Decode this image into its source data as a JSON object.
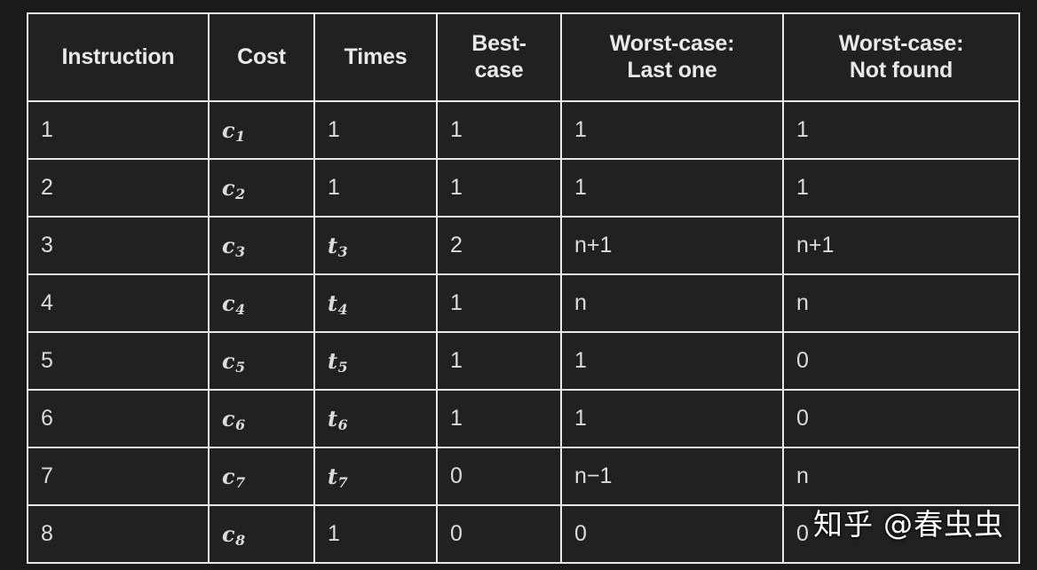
{
  "table": {
    "columns": [
      {
        "key": "instruction",
        "label": "Instruction"
      },
      {
        "key": "cost",
        "label": "Cost"
      },
      {
        "key": "times",
        "label": "Times"
      },
      {
        "key": "best_case",
        "label": "Best-case"
      },
      {
        "key": "worst_last",
        "label": "Worst-case: Last one"
      },
      {
        "key": "worst_notfound",
        "label": "Worst-case: Not found"
      }
    ],
    "header": {
      "instruction": "Instruction",
      "cost": "Cost",
      "times": "Times",
      "best_case_line1": "Best-",
      "best_case_line2": "case",
      "worst_last_line1": "Worst-case:",
      "worst_last_line2": "Last one",
      "worst_notfound_line1": "Worst-case:",
      "worst_notfound_line2": "Not found"
    },
    "rows": [
      {
        "instruction": "1",
        "cost_symbol": "c",
        "cost_sub": "1",
        "times": "1",
        "times_symbol": "",
        "times_sub": "",
        "times_is_math": false,
        "best_case": "1",
        "worst_last": "1",
        "worst_notfound": "1"
      },
      {
        "instruction": "2",
        "cost_symbol": "c",
        "cost_sub": "2",
        "times": "1",
        "times_symbol": "",
        "times_sub": "",
        "times_is_math": false,
        "best_case": "1",
        "worst_last": "1",
        "worst_notfound": "1"
      },
      {
        "instruction": "3",
        "cost_symbol": "c",
        "cost_sub": "3",
        "times": "",
        "times_symbol": "t",
        "times_sub": "3",
        "times_is_math": true,
        "best_case": "2",
        "worst_last": "n+1",
        "worst_notfound": "n+1"
      },
      {
        "instruction": "4",
        "cost_symbol": "c",
        "cost_sub": "4",
        "times": "",
        "times_symbol": "t",
        "times_sub": "4",
        "times_is_math": true,
        "best_case": "1",
        "worst_last": "n",
        "worst_notfound": "n"
      },
      {
        "instruction": "5",
        "cost_symbol": "c",
        "cost_sub": "5",
        "times": "",
        "times_symbol": "t",
        "times_sub": "5",
        "times_is_math": true,
        "best_case": "1",
        "worst_last": "1",
        "worst_notfound": "0"
      },
      {
        "instruction": "6",
        "cost_symbol": "c",
        "cost_sub": "6",
        "times": "",
        "times_symbol": "t",
        "times_sub": "6",
        "times_is_math": true,
        "best_case": "1",
        "worst_last": "1",
        "worst_notfound": "0"
      },
      {
        "instruction": "7",
        "cost_symbol": "c",
        "cost_sub": "7",
        "times": "",
        "times_symbol": "t",
        "times_sub": "7",
        "times_is_math": true,
        "best_case": "0",
        "worst_last": "n−1",
        "worst_notfound": "n"
      },
      {
        "instruction": "8",
        "cost_symbol": "c",
        "cost_sub": "8",
        "times": "1",
        "times_symbol": "",
        "times_sub": "",
        "times_is_math": false,
        "best_case": "0",
        "worst_last": "0",
        "worst_notfound": "0"
      }
    ]
  },
  "watermark": {
    "brand": "知乎",
    "user": "@春虫虫"
  },
  "colors": {
    "page_background": "#1a1a1a",
    "cell_background": "#212121",
    "border": "#e8e8e8",
    "header_text": "#e9e9e9",
    "body_text": "#dcdcdc",
    "watermark_text": "#ffffff"
  }
}
